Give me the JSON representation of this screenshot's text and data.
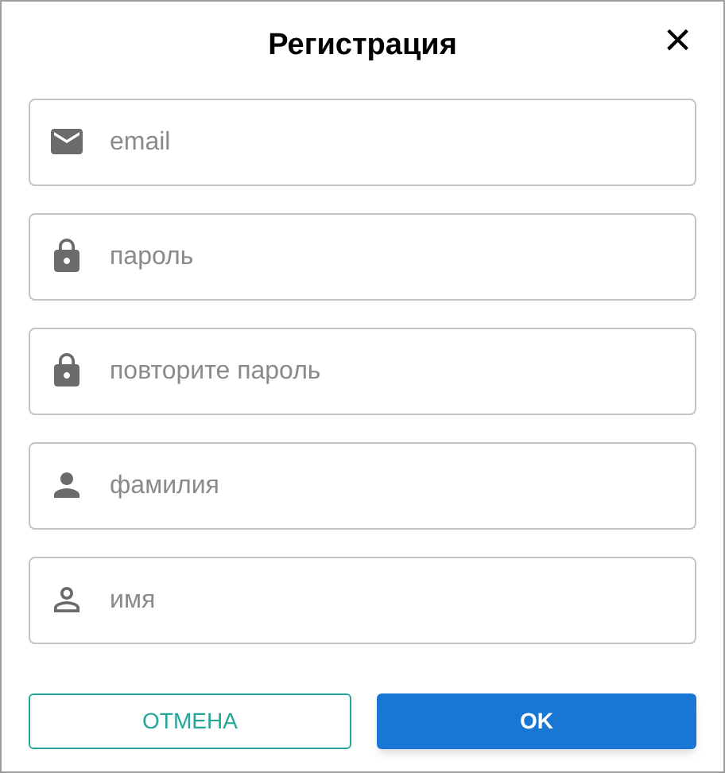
{
  "dialog": {
    "title": "Регистрация",
    "close": "×"
  },
  "fields": [
    {
      "kind": "email",
      "placeholder": "email"
    },
    {
      "kind": "password",
      "placeholder": "пароль"
    },
    {
      "kind": "password",
      "placeholder": "повторите пароль"
    },
    {
      "kind": "person",
      "placeholder": "фамилия"
    },
    {
      "kind": "person_outline",
      "placeholder": "имя"
    }
  ],
  "buttons": [
    {
      "kind": "secondary",
      "label": "ОТМЕНА"
    },
    {
      "kind": "primary",
      "label": "OK"
    }
  ]
}
